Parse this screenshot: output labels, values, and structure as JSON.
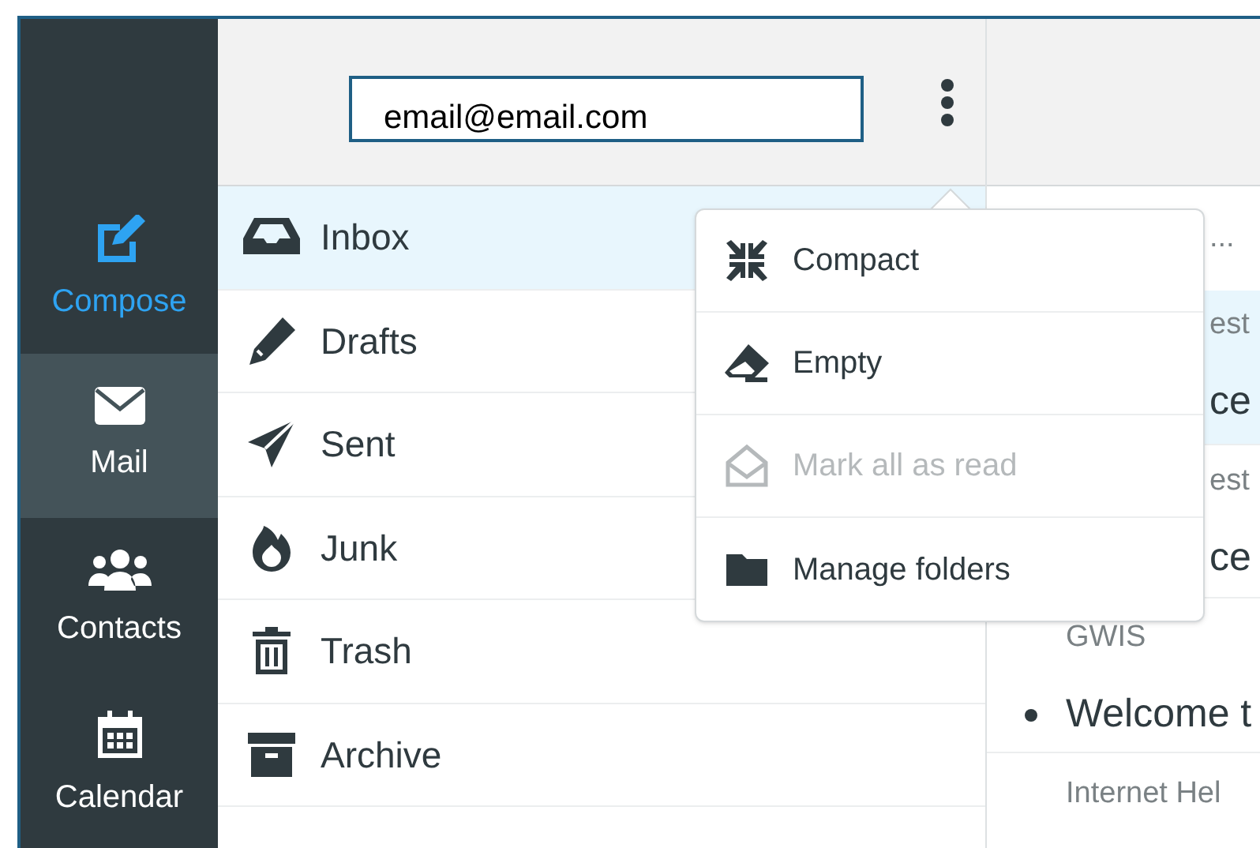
{
  "account": {
    "value": "email@email.com"
  },
  "nav": [
    {
      "label": "Compose",
      "kind": "compose",
      "selected": false
    },
    {
      "label": "Mail",
      "kind": "mail",
      "selected": true
    },
    {
      "label": "Contacts",
      "kind": "contacts",
      "selected": false
    },
    {
      "label": "Calendar",
      "kind": "calendar",
      "selected": false
    }
  ],
  "folders": [
    {
      "label": "Inbox",
      "kind": "inbox",
      "selected": true
    },
    {
      "label": "Drafts",
      "kind": "drafts",
      "selected": false
    },
    {
      "label": "Sent",
      "kind": "sent",
      "selected": false
    },
    {
      "label": "Junk",
      "kind": "junk",
      "selected": false
    },
    {
      "label": "Trash",
      "kind": "trash",
      "selected": false
    },
    {
      "label": "Archive",
      "kind": "archive",
      "selected": false
    }
  ],
  "menu": [
    {
      "label": "Compact",
      "kind": "compact",
      "disabled": false
    },
    {
      "label": "Empty",
      "kind": "empty",
      "disabled": false
    },
    {
      "label": "Mark all as read",
      "kind": "read",
      "disabled": true
    },
    {
      "label": "Manage folders",
      "kind": "folder",
      "disabled": false
    }
  ],
  "messages": [
    {
      "text": "...",
      "kind": "meta",
      "unread": false,
      "selected": false
    },
    {
      "text": "est",
      "kind": "meta",
      "unread": false,
      "selected": true
    },
    {
      "text": "ce",
      "kind": "subject",
      "unread": false,
      "selected": true
    },
    {
      "text": "est",
      "kind": "meta",
      "unread": false,
      "selected": false
    },
    {
      "text": "ce",
      "kind": "subject",
      "unread": false,
      "selected": false
    },
    {
      "text": "GWIS",
      "kind": "meta",
      "unread": false,
      "selected": false
    },
    {
      "text": "Welcome t",
      "kind": "subject",
      "unread": true,
      "selected": false
    },
    {
      "text": "Internet Hel",
      "kind": "meta",
      "unread": false,
      "selected": false
    }
  ]
}
